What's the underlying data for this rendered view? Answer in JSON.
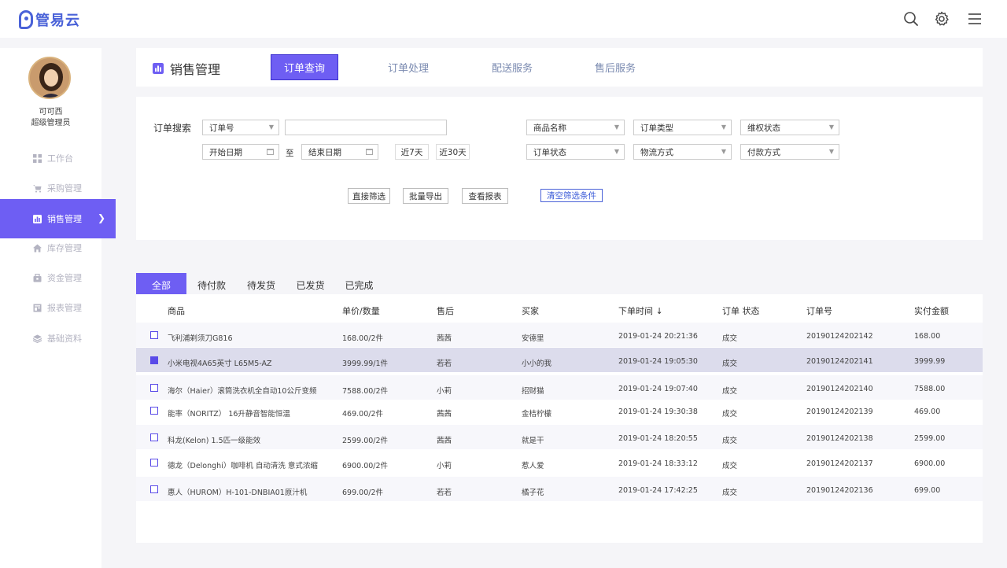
{
  "app": {
    "name": "管易云"
  },
  "user": {
    "name": "可可西",
    "role": "超级管理员"
  },
  "sidebar": {
    "items": [
      {
        "label": "工作台",
        "icon": "grid-icon"
      },
      {
        "label": "采购管理",
        "icon": "cart-icon"
      },
      {
        "label": "销售管理",
        "icon": "chart-icon",
        "active": true
      },
      {
        "label": "库存管理",
        "icon": "house-icon"
      },
      {
        "label": "资金管理",
        "icon": "wallet-icon"
      },
      {
        "label": "报表管理",
        "icon": "report-icon"
      },
      {
        "label": "基础资料",
        "icon": "layers-icon"
      }
    ]
  },
  "header": {
    "title": "销售管理",
    "tabs": [
      "订单查询",
      "订单处理",
      "配送服务",
      "售后服务"
    ]
  },
  "filters": {
    "search_label": "订单搜索",
    "order_field": "订单号",
    "search_value": "",
    "start_date": "开始日期",
    "to": "至",
    "end_date": "结束日期",
    "last7": "近7天",
    "last30": "近30天",
    "product_name": "商品名称",
    "order_type": "订单类型",
    "rights_status": "维权状态",
    "order_status": "订单状态",
    "logistics": "物流方式",
    "payment": "付款方式",
    "btn_filter": "直接筛选",
    "btn_export": "批量导出",
    "btn_report": "查看报表",
    "btn_clear": "清空筛选条件"
  },
  "status_tabs": [
    "全部",
    "待付款",
    "待发货",
    "已发货",
    "已完成"
  ],
  "table": {
    "columns": [
      "商品",
      "单价/数量",
      "售后",
      "买家",
      "下单时间 ↓",
      "订单 状态",
      "订单号",
      "实付金额"
    ],
    "rows": [
      {
        "product": "飞利浦剃须刀G816",
        "price": "168.00/2件",
        "after": "茜茜",
        "buyer": "安德里",
        "time": "2019-01-24 20:21:36",
        "status": "成交",
        "order_no": "20190124202142",
        "amount": "168.00",
        "checked": false
      },
      {
        "product": "小米电视4A65英寸 L65M5-AZ",
        "price": "3999.99/1件",
        "after": "若若",
        "buyer": "小小的我",
        "time": "2019-01-24 19:05:30",
        "status": "成交",
        "order_no": "20190124202141",
        "amount": "3999.99",
        "checked": true
      },
      {
        "product": "海尔（Haier）滚筒洗衣机全自动10公斤变频",
        "price": "7588.00/2件",
        "after": "小莉",
        "buyer": "招财猫",
        "time": "2019-01-24 19:07:40",
        "status": "成交",
        "order_no": "20190124202140",
        "amount": "7588.00",
        "checked": false
      },
      {
        "product": "能率（NORITZ） 16升静音智能恒温",
        "price": "469.00/2件",
        "after": "茜茜",
        "buyer": "金桔柠檬",
        "time": "2019-01-24 19:30:38",
        "status": "成交",
        "order_no": "20190124202139",
        "amount": "469.00",
        "checked": false
      },
      {
        "product": "科龙(Kelon) 1.5匹一级能效",
        "price": "2599.00/2件",
        "after": "茜茜",
        "buyer": "就是干",
        "time": "2019-01-24 18:20:55",
        "status": "成交",
        "order_no": "20190124202138",
        "amount": "2599.00",
        "checked": false
      },
      {
        "product": "德龙（Delonghi）咖啡机 自动清洗 意式浓缩",
        "price": "6900.00/2件",
        "after": "小莉",
        "buyer": "惹人爱",
        "time": "2019-01-24 18:33:12",
        "status": "成交",
        "order_no": "20190124202137",
        "amount": "6900.00",
        "checked": false
      },
      {
        "product": "惠人（HUROM）H-101-DNBIA01原汁机",
        "price": "699.00/2件",
        "after": "若若",
        "buyer": "橘子花",
        "time": "2019-01-24 17:42:25",
        "status": "成交",
        "order_no": "20190124202136",
        "amount": "699.00",
        "checked": false
      }
    ]
  },
  "colors": {
    "accent": "#6e5ef3",
    "brand": "#4a62d8"
  }
}
